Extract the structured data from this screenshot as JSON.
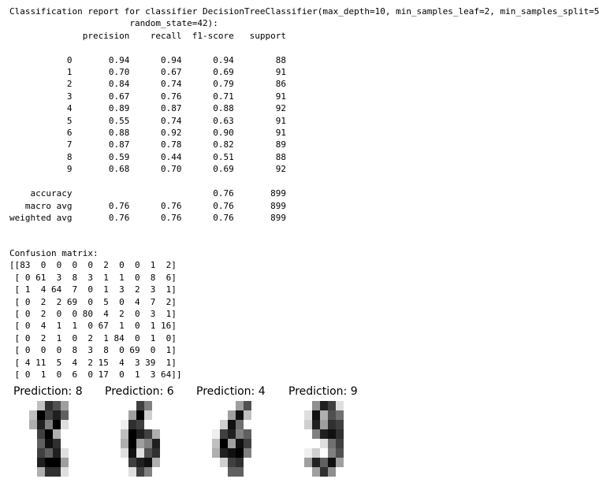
{
  "report": {
    "title": "Classification report for classifier DecisionTreeClassifier(max_depth=10, min_samples_leaf=2, min_samples_split=5,",
    "title_cont": "                       random_state=42):",
    "header": "              precision    recall  f1-score   support",
    "rows": [
      "           0       0.94      0.94      0.94        88",
      "           1       0.70      0.67      0.69        91",
      "           2       0.84      0.74      0.79        86",
      "           3       0.67      0.76      0.71        91",
      "           4       0.89      0.87      0.88        92",
      "           5       0.55      0.74      0.63        91",
      "           6       0.88      0.92      0.90        91",
      "           7       0.87      0.78      0.82        89",
      "           8       0.59      0.44      0.51        88",
      "           9       0.68      0.70      0.69        92"
    ],
    "summary": [
      "    accuracy                           0.76       899",
      "   macro avg       0.76      0.76      0.76       899",
      "weighted avg       0.76      0.76      0.76       899"
    ]
  },
  "confusion": {
    "title": "Confusion matrix:",
    "rows": [
      "[[83  0  0  0  0  2  0  0  1  2]",
      " [ 0 61  3  8  3  1  1  0  8  6]",
      " [ 1  4 64  7  0  1  3  2  3  1]",
      " [ 0  2  2 69  0  5  0  4  7  2]",
      " [ 0  2  0  0 80  4  2  0  3  1]",
      " [ 0  4  1  1  0 67  1  0  1 16]",
      " [ 0  2  1  0  2  1 84  0  1  0]",
      " [ 0  0  0  8  3  8  0 69  0  1]",
      " [ 4 11  5  4  2 15  4  3 39  1]",
      " [ 0  1  0  6  0 17  0  1  3 64]]"
    ]
  },
  "predictions": [
    {
      "label": "Prediction: 8",
      "pixels": [
        [
          0,
          0,
          4,
          13,
          11,
          6,
          0,
          0
        ],
        [
          0,
          4,
          16,
          12,
          14,
          10,
          0,
          0
        ],
        [
          0,
          5,
          14,
          8,
          16,
          2,
          0,
          0
        ],
        [
          0,
          0,
          12,
          16,
          5,
          0,
          0,
          0
        ],
        [
          0,
          0,
          10,
          15,
          13,
          0,
          0,
          0
        ],
        [
          0,
          0,
          12,
          10,
          14,
          2,
          0,
          0
        ],
        [
          0,
          0,
          14,
          16,
          16,
          6,
          0,
          0
        ],
        [
          0,
          0,
          5,
          13,
          13,
          2,
          0,
          0
        ]
      ]
    },
    {
      "label": "Prediction: 6",
      "pixels": [
        [
          0,
          0,
          0,
          12,
          8,
          0,
          0,
          0
        ],
        [
          0,
          0,
          6,
          16,
          3,
          0,
          0,
          0
        ],
        [
          0,
          1,
          13,
          12,
          0,
          0,
          0,
          0
        ],
        [
          0,
          4,
          16,
          14,
          12,
          5,
          0,
          0
        ],
        [
          0,
          5,
          16,
          6,
          8,
          14,
          0,
          0
        ],
        [
          0,
          2,
          15,
          2,
          11,
          13,
          0,
          0
        ],
        [
          0,
          0,
          12,
          14,
          15,
          5,
          0,
          0
        ],
        [
          0,
          0,
          2,
          12,
          8,
          0,
          0,
          0
        ]
      ]
    },
    {
      "label": "Prediction: 4",
      "pixels": [
        [
          0,
          0,
          0,
          0,
          6,
          11,
          0,
          0
        ],
        [
          0,
          0,
          0,
          6,
          15,
          4,
          0,
          0
        ],
        [
          0,
          0,
          3,
          15,
          9,
          0,
          0,
          0
        ],
        [
          0,
          1,
          12,
          14,
          8,
          10,
          0,
          0
        ],
        [
          0,
          4,
          16,
          6,
          15,
          12,
          0,
          0
        ],
        [
          0,
          5,
          14,
          15,
          16,
          8,
          0,
          0
        ],
        [
          0,
          0,
          3,
          12,
          13,
          0,
          0,
          0
        ],
        [
          0,
          0,
          0,
          10,
          10,
          0,
          0,
          0
        ]
      ]
    },
    {
      "label": "Prediction: 9",
      "pixels": [
        [
          0,
          0,
          7,
          14,
          12,
          2,
          0,
          0
        ],
        [
          0,
          2,
          15,
          5,
          11,
          9,
          0,
          0
        ],
        [
          0,
          3,
          14,
          6,
          13,
          12,
          0,
          0
        ],
        [
          0,
          0,
          8,
          14,
          15,
          13,
          0,
          0
        ],
        [
          0,
          0,
          0,
          2,
          9,
          12,
          0,
          0
        ],
        [
          0,
          1,
          3,
          0,
          8,
          11,
          0,
          0
        ],
        [
          0,
          6,
          14,
          10,
          15,
          6,
          0,
          0
        ],
        [
          0,
          0,
          6,
          13,
          7,
          0,
          0,
          0
        ]
      ]
    }
  ]
}
